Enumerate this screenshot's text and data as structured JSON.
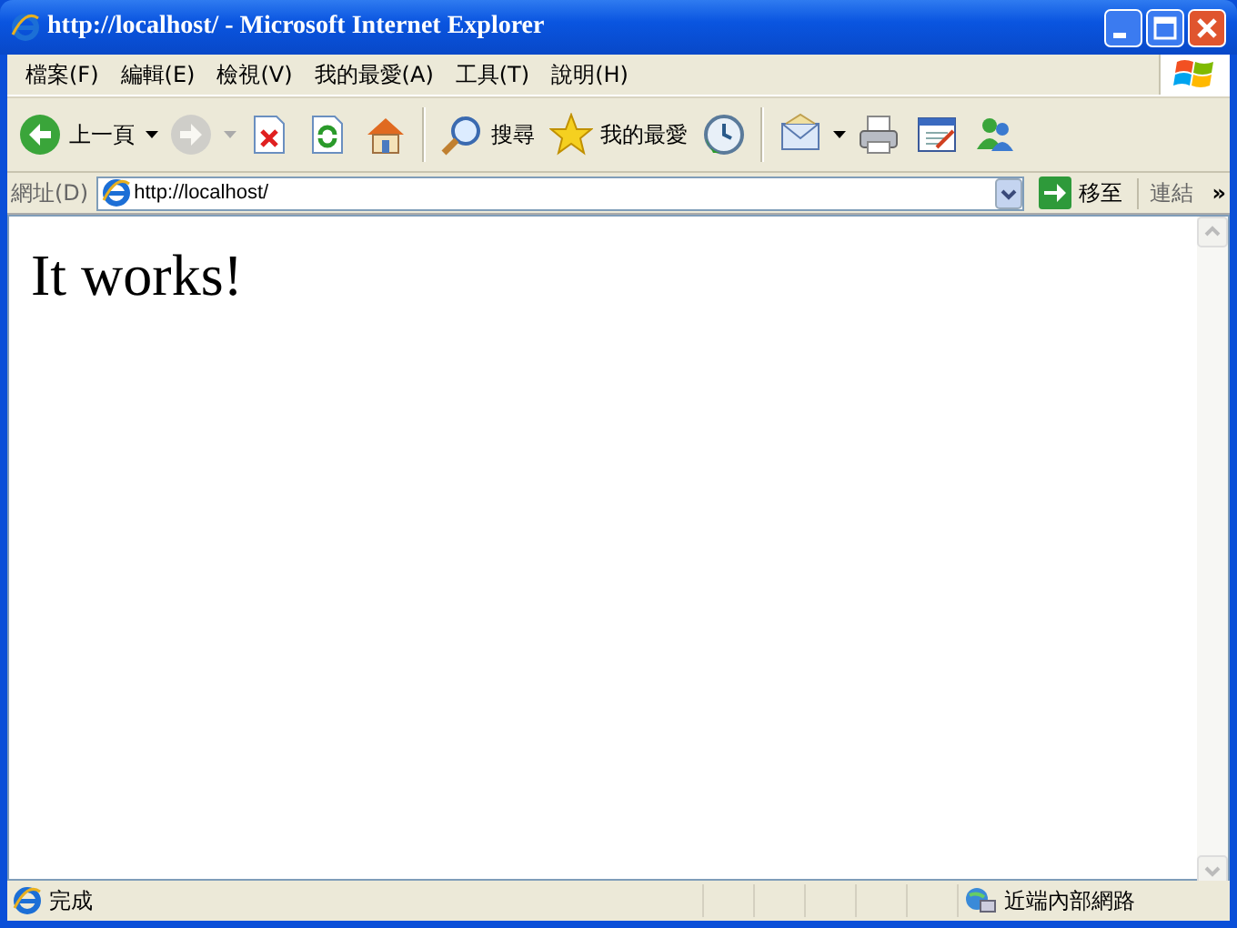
{
  "window": {
    "title": "http://localhost/ - Microsoft Internet Explorer"
  },
  "menu": [
    {
      "label": "檔案(F)"
    },
    {
      "label": "編輯(E)"
    },
    {
      "label": "檢視(V)"
    },
    {
      "label": "我的最愛(A)"
    },
    {
      "label": "工具(T)"
    },
    {
      "label": "說明(H)"
    }
  ],
  "toolbar": [
    {
      "kind": "back",
      "label": "上一頁",
      "dropdown": true,
      "disabled": false
    },
    {
      "kind": "forward",
      "dropdown": true,
      "disabled": true
    },
    {
      "kind": "stop",
      "disabled": false
    },
    {
      "kind": "refresh",
      "disabled": false
    },
    {
      "kind": "home",
      "disabled": false
    },
    {
      "kind": "separator"
    },
    {
      "kind": "search",
      "label": "搜尋",
      "disabled": false
    },
    {
      "kind": "favorites",
      "label": "我的最愛",
      "disabled": false
    },
    {
      "kind": "history",
      "disabled": false
    },
    {
      "kind": "separator"
    },
    {
      "kind": "mail",
      "dropdown": true,
      "disabled": false
    },
    {
      "kind": "print",
      "disabled": false
    },
    {
      "kind": "edit",
      "disabled": false
    },
    {
      "kind": "messenger",
      "disabled": false
    }
  ],
  "address_bar": {
    "label": "網址(D)",
    "value": "http://localhost/",
    "go_button": "移至",
    "links": "連結",
    "chevron": "»"
  },
  "page": {
    "heading": "It works!"
  },
  "status_bar": {
    "text": "完成",
    "zone": "近端內部網路"
  }
}
